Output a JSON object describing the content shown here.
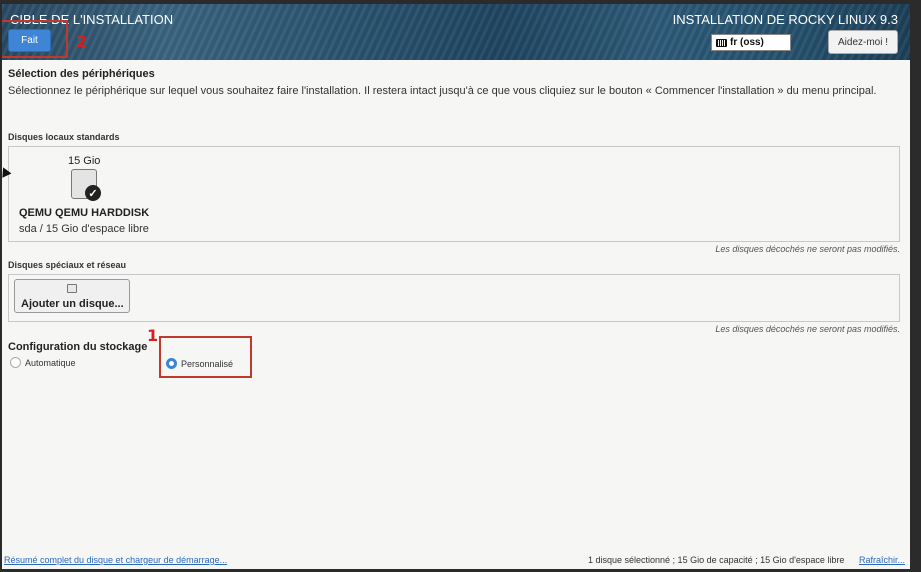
{
  "header": {
    "title": "CIBLE DE L'INSTALLATION",
    "done_button": "Fait",
    "product_title": "INSTALLATION DE ROCKY LINUX 9.3",
    "keyboard_layout": "fr (oss)",
    "help_button": "Aidez-moi !"
  },
  "annotations": {
    "marker_1": "1",
    "marker_2": "2",
    "accent_color": "#d42020"
  },
  "device_selection": {
    "title": "Sélection des périphériques",
    "description": "Sélectionnez le périphérique sur lequel vous souhaitez faire l'installation. Il restera intact jusqu'à ce que vous cliquiez sur le bouton « Commencer l'installation » du menu principal."
  },
  "local_disks": {
    "label": "Disques locaux standards",
    "disks": [
      {
        "size": "15 Gio",
        "name": "QEMU QEMU HARDDISK",
        "info": "sda / 15 Gio d'espace libre",
        "selected": true
      }
    ],
    "note": "Les disques décochés ne seront pas modifiés."
  },
  "special_disks": {
    "label": "Disques spéciaux et réseau",
    "add_button": "Ajouter un disque...",
    "note": "Les disques décochés ne seront pas modifiés."
  },
  "storage_config": {
    "title": "Configuration du stockage",
    "options": [
      {
        "label": "Automatique",
        "selected": false
      },
      {
        "label": "Personnalisé",
        "selected": true
      }
    ]
  },
  "footer": {
    "summary_link": "Résumé complet du disque et chargeur de démarrage...",
    "status": "1 disque sélectionné ; 15 Gio de capacité ; 15 Gio d'espace libre",
    "refresh_link": "Rafraîchir..."
  },
  "colors": {
    "primary_button": "#3f85d6",
    "link": "#2a6ac0"
  }
}
